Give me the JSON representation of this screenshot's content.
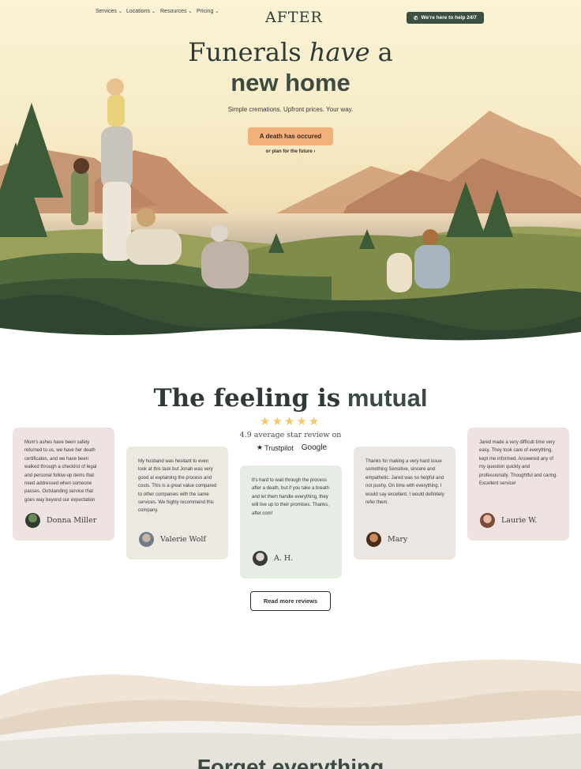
{
  "nav": {
    "items": [
      {
        "label": "Services"
      },
      {
        "label": "Locations"
      },
      {
        "label": "Resources"
      },
      {
        "label": "Pricing"
      }
    ],
    "logo": "AFTER",
    "help_button": "We're here to help 24/7"
  },
  "hero": {
    "title_part1": "Funerals",
    "title_italic": "have",
    "title_part2": "a",
    "title_line2": "new home",
    "subtitle": "Simple cremations. Upfront prices. Your way.",
    "cta": "A death has occured",
    "plan_link": "or plan for the future"
  },
  "reviews": {
    "title_part1": "The feeling is",
    "title_bold": "mutual",
    "rating": 5,
    "average_text": "4.9 average star review on",
    "trustpilot": "Trustpilot",
    "google": "Google",
    "cards": [
      {
        "text": "Mom's ashes have been safely returned to us, we have her death certificates, and we have been walked through a checklist of legal and personal follow-up items that need addressed when someone passes. Outstanding service that goes way beyond our expectation",
        "author": "Donna Miller"
      },
      {
        "text": "My husband was hesitant to even look at this task but Jonah was very good at explaining the process and costs. This is a great value compared to other companies with the same services. We highly recommend this company.",
        "author": "Valerie Wolf"
      },
      {
        "text": "It's hard to wait through the process after a death, but if you take a breath and let them handle everything, they will live up to their promises. Thanks, after.com!",
        "author": "A. H."
      },
      {
        "text": "Thanks for making a very hard issue something Sensitive, sincere and empathetic. Jared was so helpful and not pushy. On time with everything. I would say excellent. I would definitely refer them.",
        "author": "Mary"
      },
      {
        "text": "Jared made a very difficult time very easy. They took care of everything, kept me informed. Answered any of my question quickly and professionally. Thoughtful and caring. Excellent service!",
        "author": "Laurie W."
      }
    ],
    "more_button": "Read more reviews"
  },
  "footer_teaser": {
    "title": "Forget everything"
  },
  "colors": {
    "accent_cta": "#f2b07b",
    "dark_green": "#3d4f43",
    "card_pink": "#efe3e1",
    "card_grey": "#ebe9e2",
    "card_green": "#e6ede4"
  }
}
